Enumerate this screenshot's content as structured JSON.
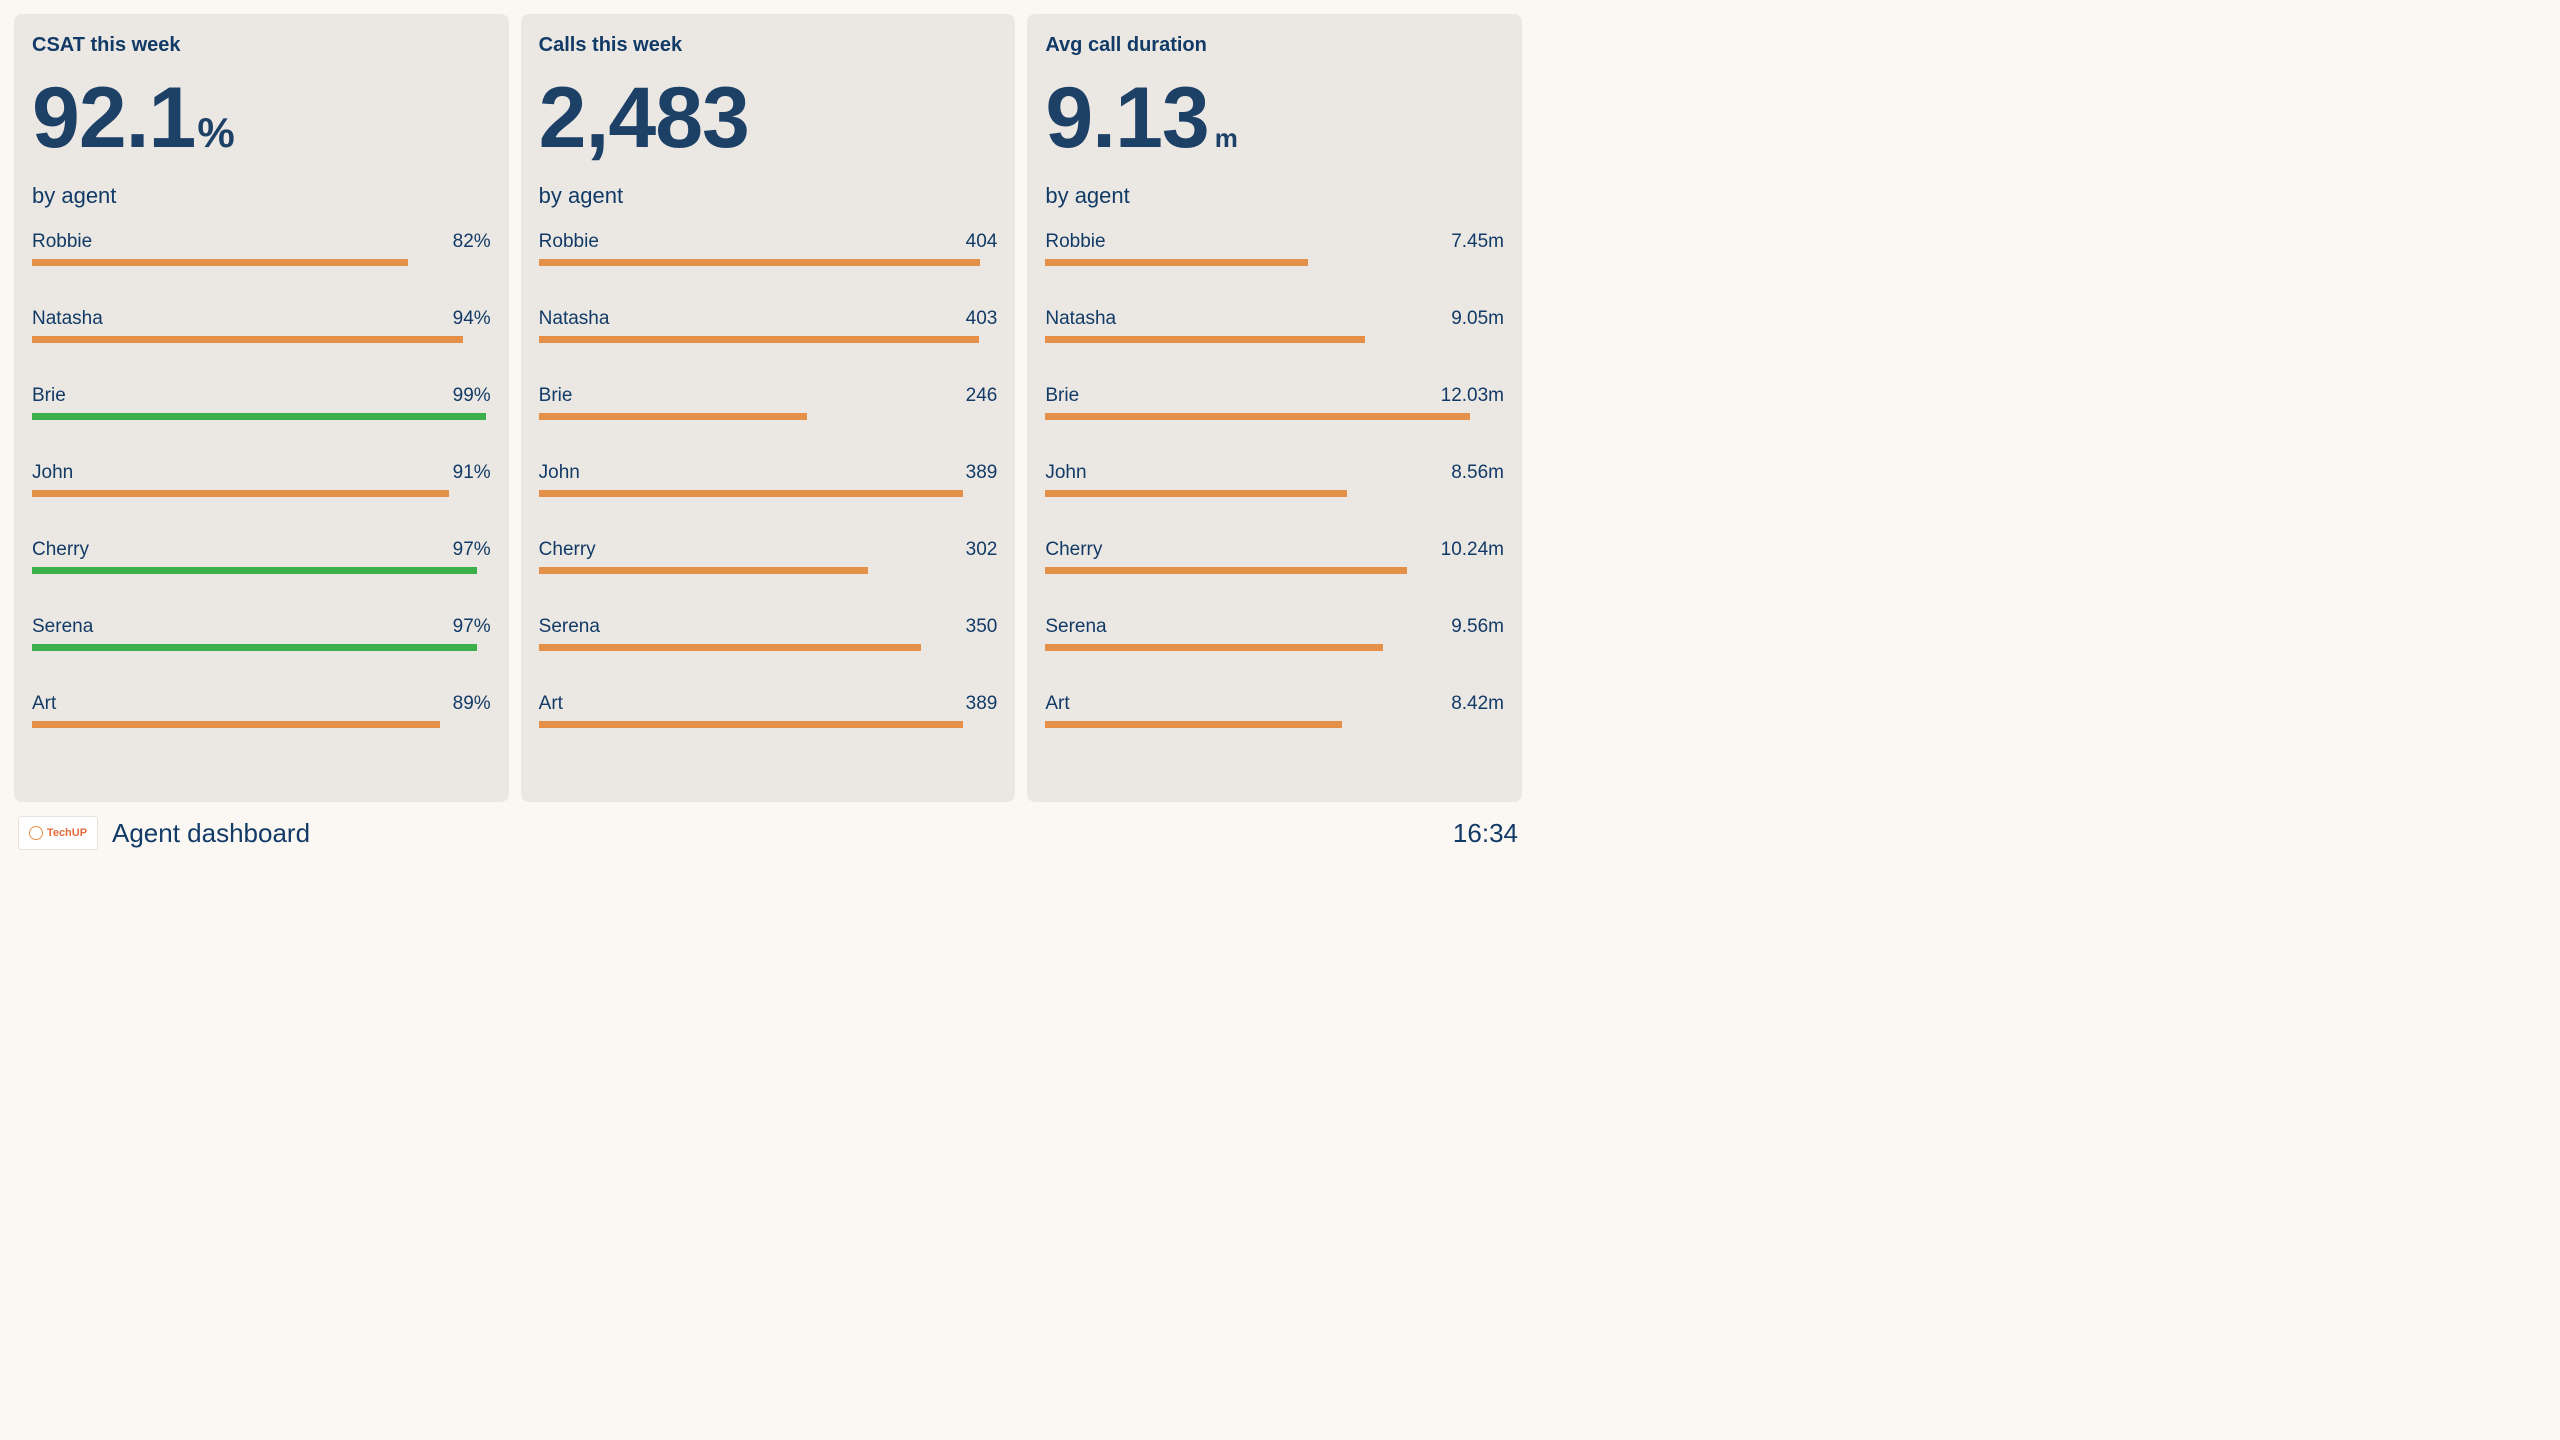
{
  "panels": {
    "csat": {
      "title": "CSAT this week",
      "value": "92.1",
      "unit": "%",
      "sub": "by agent",
      "target_min": 95,
      "target_max": 100,
      "has_target_band": true,
      "max": 100,
      "rows": [
        {
          "name": "Robbie",
          "value_label": "82%",
          "bar": 82,
          "color": "orange"
        },
        {
          "name": "Natasha",
          "value_label": "94%",
          "bar": 94,
          "color": "orange"
        },
        {
          "name": "Brie",
          "value_label": "99%",
          "bar": 99,
          "color": "green"
        },
        {
          "name": "John",
          "value_label": "91%",
          "bar": 91,
          "color": "orange"
        },
        {
          "name": "Cherry",
          "value_label": "97%",
          "bar": 97,
          "color": "green"
        },
        {
          "name": "Serena",
          "value_label": "97%",
          "bar": 97,
          "color": "green"
        },
        {
          "name": "Art",
          "value_label": "89%",
          "bar": 89,
          "color": "orange"
        }
      ]
    },
    "calls": {
      "title": "Calls this week",
      "value": "2,483",
      "unit": "",
      "sub": "by agent",
      "has_target_band": false,
      "max": 420,
      "rows": [
        {
          "name": "Robbie",
          "value_label": "404",
          "bar": 404,
          "color": "orange"
        },
        {
          "name": "Natasha",
          "value_label": "403",
          "bar": 403,
          "color": "orange"
        },
        {
          "name": "Brie",
          "value_label": "246",
          "bar": 246,
          "color": "orange"
        },
        {
          "name": "John",
          "value_label": "389",
          "bar": 389,
          "color": "orange"
        },
        {
          "name": "Cherry",
          "value_label": "302",
          "bar": 302,
          "color": "orange"
        },
        {
          "name": "Serena",
          "value_label": "350",
          "bar": 350,
          "color": "orange"
        },
        {
          "name": "Art",
          "value_label": "389",
          "bar": 389,
          "color": "orange"
        }
      ]
    },
    "duration": {
      "title": "Avg call duration",
      "value": "9.13",
      "unit": "m",
      "unit_small": true,
      "sub": "by agent",
      "has_target_band": false,
      "max": 13,
      "rows": [
        {
          "name": "Robbie",
          "value_label": "7.45m",
          "bar": 7.45,
          "color": "orange"
        },
        {
          "name": "Natasha",
          "value_label": "9.05m",
          "bar": 9.05,
          "color": "orange"
        },
        {
          "name": "Brie",
          "value_label": "12.03m",
          "bar": 12.03,
          "color": "orange"
        },
        {
          "name": "John",
          "value_label": "8.56m",
          "bar": 8.56,
          "color": "orange"
        },
        {
          "name": "Cherry",
          "value_label": "10.24m",
          "bar": 10.24,
          "color": "orange"
        },
        {
          "name": "Serena",
          "value_label": "9.56m",
          "bar": 9.56,
          "color": "orange"
        },
        {
          "name": "Art",
          "value_label": "8.42m",
          "bar": 8.42,
          "color": "orange"
        }
      ]
    }
  },
  "footer": {
    "logo_text": "TechUP",
    "title": "Agent dashboard",
    "time": "16:34"
  },
  "chart_data": [
    {
      "type": "bar",
      "title": "CSAT this week",
      "xlabel": "",
      "ylabel": "by agent",
      "categories": [
        "Robbie",
        "Natasha",
        "Brie",
        "John",
        "Cherry",
        "Serena",
        "Art"
      ],
      "values": [
        82,
        94,
        99,
        91,
        97,
        97,
        89
      ],
      "value_suffix": "%",
      "target_band": [
        95,
        100
      ],
      "ylim": [
        0,
        100
      ]
    },
    {
      "type": "bar",
      "title": "Calls this week",
      "xlabel": "",
      "ylabel": "by agent",
      "categories": [
        "Robbie",
        "Natasha",
        "Brie",
        "John",
        "Cherry",
        "Serena",
        "Art"
      ],
      "values": [
        404,
        403,
        246,
        389,
        302,
        350,
        389
      ],
      "ylim": [
        0,
        420
      ]
    },
    {
      "type": "bar",
      "title": "Avg call duration",
      "xlabel": "",
      "ylabel": "by agent",
      "categories": [
        "Robbie",
        "Natasha",
        "Brie",
        "John",
        "Cherry",
        "Serena",
        "Art"
      ],
      "values": [
        7.45,
        9.05,
        12.03,
        8.56,
        10.24,
        9.56,
        8.42
      ],
      "value_suffix": "m",
      "ylim": [
        0,
        13
      ]
    }
  ]
}
